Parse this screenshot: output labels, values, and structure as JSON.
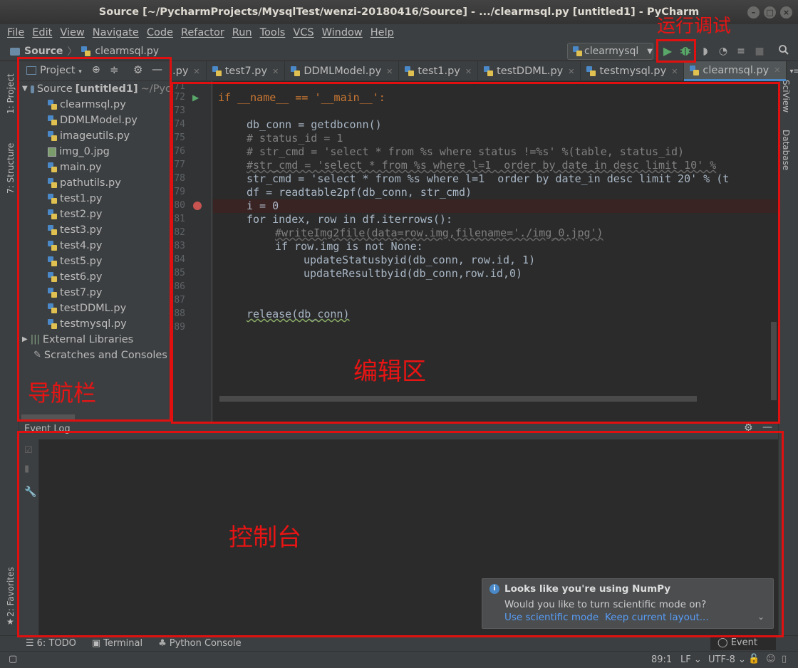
{
  "window": {
    "title": "Source [~/PycharmProjects/MysqlTest/wenzi-20180416/Source] - .../clearmsql.py [untitled1] - PyCharm"
  },
  "menu": [
    "File",
    "Edit",
    "View",
    "Navigate",
    "Code",
    "Refactor",
    "Run",
    "Tools",
    "VCS",
    "Window",
    "Help"
  ],
  "breadcrumb": {
    "folder": "Source",
    "file": "clearmsql.py"
  },
  "run_config": {
    "name": "clearmysql"
  },
  "project": {
    "title": "Project",
    "root_label": "Source",
    "root_module": "[untitled1]",
    "root_path": "~/Pyc",
    "files": [
      "clearmsql.py",
      "DDMLModel.py",
      "imageutils.py",
      "img_0.jpg",
      "main.py",
      "pathutils.py",
      "test1.py",
      "test2.py",
      "test3.py",
      "test4.py",
      "test5.py",
      "test6.py",
      "test7.py",
      "testDDML.py",
      "testmysql.py"
    ],
    "external_libraries": "External Libraries",
    "scratches": "Scratches and Consoles"
  },
  "tabs": [
    {
      "label": ".py",
      "active": false
    },
    {
      "label": "test7.py",
      "active": false
    },
    {
      "label": "DDMLModel.py",
      "active": false
    },
    {
      "label": "test1.py",
      "active": false
    },
    {
      "label": "testDDML.py",
      "active": false
    },
    {
      "label": "testmysql.py",
      "active": false
    },
    {
      "label": "clearmsql.py",
      "active": true
    }
  ],
  "editor": {
    "line_numbers": [
      "71",
      "72",
      "73",
      "74",
      "75",
      "76",
      "77",
      "78",
      "79",
      "80",
      "81",
      "82",
      "83",
      "84",
      "85",
      "86",
      "87",
      "88",
      "89"
    ],
    "breakpoint_line": "80",
    "code": {
      "l72": "if __name__ == '__main__':",
      "l74": "db_conn = getdbconn()",
      "l75": "# status_id = 1",
      "l76": "# str_cmd = 'select * from %s where status !=%s' %(table, status_id)",
      "l77": "#str_cmd = 'select * from %s where l=1  order by date_in desc limit 10' %",
      "l78": "str_cmd = 'select * from %s where l=1  order by date_in desc limit 20' % (t",
      "l79": "df = readtable2pf(db_conn, str_cmd)",
      "l80": "i = 0",
      "l81": "for index, row in df.iterrows():",
      "l82": "#writeImg2file(data=row.img,filename='./img_0.jpg')",
      "l83": "if row.img is not None:",
      "l84": "updateStatusbyid(db_conn, row.id, 1)",
      "l85": "updateResultbyid(db_conn,row.id,0)",
      "l88": "release(db_conn)"
    }
  },
  "left_strip": {
    "project": "1: Project",
    "structure": "7: Structure",
    "favorites": "2: Favorites"
  },
  "right_strip": {
    "sciview": "SciView",
    "database": "Database"
  },
  "event_log": {
    "title": "Event Log"
  },
  "notification": {
    "title": "Looks like you're using NumPy",
    "body": "Would you like to turn scientific mode on?",
    "action1": "Use scientific mode",
    "action2": "Keep current layout..."
  },
  "tool_windows": [
    "6: TODO",
    "Terminal",
    "Python Console"
  ],
  "event_log_button": "Event Log",
  "status": {
    "position": "89:1",
    "line_sep": "LF",
    "encoding": "UTF-8"
  },
  "annotations": {
    "run_debug": "运行调试",
    "nav": "导航栏",
    "editor": "编辑区",
    "console": "控制台"
  },
  "colors": {
    "annotation_red": "#e01010",
    "accent_blue": "#4a88c7",
    "run_green": "#59a869"
  }
}
